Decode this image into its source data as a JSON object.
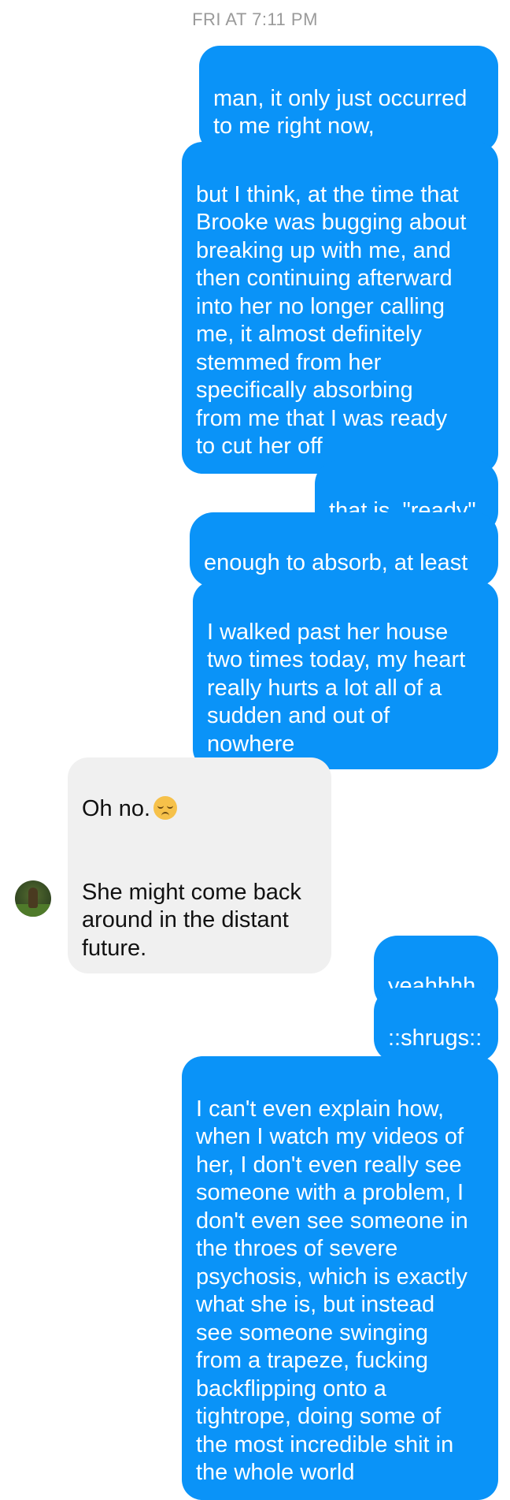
{
  "conversation": {
    "timestamp": "FRI AT 7:11 PM",
    "messages": [
      {
        "from": "me",
        "text": "man, it only just occurred\nto me right now,"
      },
      {
        "from": "me",
        "text": "but I think, at the time that\nBrooke was bugging about\nbreaking up with me, and\nthen continuing afterward\ninto her no longer calling\nme, it almost definitely\nstemmed from her\nspecifically absorbing\nfrom me that I was ready\nto cut her off"
      },
      {
        "from": "me",
        "text": "that is, \"ready\""
      },
      {
        "from": "me",
        "text": "enough to absorb, at least"
      },
      {
        "from": "me",
        "text": "I walked past her house\ntwo times today, my heart\nreally hurts a lot all of a\nsudden and out of\nnowhere"
      },
      {
        "from": "them",
        "text_line1": "Oh no.",
        "emoji": "pensive-face-emoji",
        "text_rest": "She might come back\naround in the distant\nfuture."
      },
      {
        "from": "me",
        "text": "yeahhhh,"
      },
      {
        "from": "me",
        "text": "::shrugs::"
      },
      {
        "from": "me",
        "text": "I can't even explain how,\nwhen I watch my videos of\nher, I don't even really see\nsomeone with a problem, I\ndon't even see someone in\nthe throes of severe\npsychosis, which is exactly\nwhat she is, but instead\nsee someone swinging\nfrom a trapeze, fucking\nbackflipping onto a\ntightrope, doing some of\nthe most incredible shit in\nthe whole world"
      }
    ]
  },
  "colors": {
    "outgoing_bubble": "#0a93f8",
    "incoming_bubble": "#f0f0f0",
    "timestamp_text": "#9a9a9a"
  }
}
